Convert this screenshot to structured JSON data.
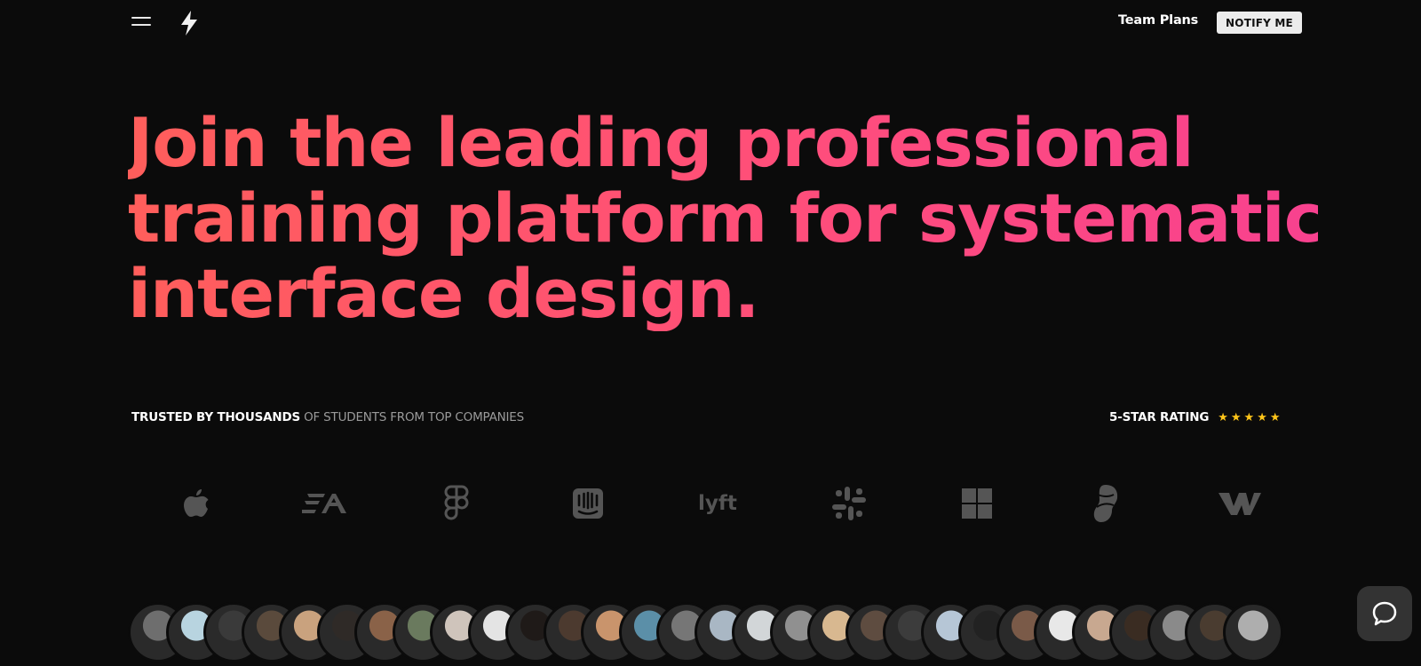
{
  "nav": {
    "menu_icon": "hamburger-icon",
    "logo_icon": "lightning-bolt-icon",
    "team_plans": "Team Plans",
    "notify_label": "NOTIFY ME"
  },
  "hero": {
    "line1": "Join the leading professional",
    "line2": "training platform for systematic",
    "line3": "interface design.",
    "gradient_start": "#ff5e5b",
    "gradient_end": "#f8418f"
  },
  "trust": {
    "strong": "TRUSTED BY THOUSANDS",
    "rest": "OF STUDENTS FROM TOP COMPANIES"
  },
  "rating": {
    "label": "5-STAR RATING",
    "stars": "★★★★★",
    "star_count": 5,
    "star_color": "#ffc61a"
  },
  "companies": [
    {
      "name": "apple-logo-icon"
    },
    {
      "name": "ea-logo-icon"
    },
    {
      "name": "figma-logo-icon"
    },
    {
      "name": "intercom-logo-icon"
    },
    {
      "name": "lyft-logo-icon",
      "text": "lyft"
    },
    {
      "name": "slack-logo-icon"
    },
    {
      "name": "microsoft-logo-icon"
    },
    {
      "name": "logo-leaf-icon"
    },
    {
      "name": "webflow-logo-icon"
    }
  ],
  "avatar_colors": [
    "#6e6e6e",
    "#b8d4e0",
    "#3a3a3a",
    "#5a4a3c",
    "#c9a27e",
    "#2f2a27",
    "#8a6248",
    "#6a7a5e",
    "#cfc4bb",
    "#e4e4e4",
    "#1f1a18",
    "#4c3a2f",
    "#c9946c",
    "#5b8fa8",
    "#767676",
    "#a9b7c4",
    "#d2d6d8",
    "#909090",
    "#d8b890",
    "#5e4c40",
    "#3c3c3c",
    "#b6c6d6",
    "#222222",
    "#7a5a48",
    "#e8e8e8",
    "#c8a890",
    "#3a2c22",
    "#8a8a8a",
    "#4a3c30",
    "#aeaeae"
  ],
  "chat": {
    "icon": "chat-bubble-icon"
  }
}
